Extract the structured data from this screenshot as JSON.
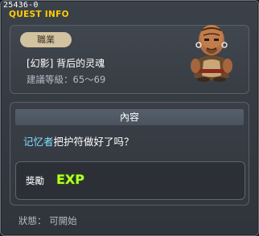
{
  "window": {
    "quest_id": "25436-0",
    "title": "QUEST INFO"
  },
  "quest": {
    "job_badge": "職業",
    "name": "[幻影] 背后的灵魂",
    "level_label": "建議等級：65～69"
  },
  "content": {
    "header": "內容",
    "npc_name": "记忆者",
    "text": "把护符做好了吗？"
  },
  "reward": {
    "label": "獎勵",
    "exp_text": "EXP"
  },
  "status": "狀態： 可開始",
  "colors": {
    "title": "#ffcc00",
    "npc_name": "#7ee0ff",
    "badge_bg": "#d3c2a0",
    "exp_fill": "#b8ff2e"
  },
  "icons": [
    "npc-portrait-icon",
    "exp-icon"
  ]
}
